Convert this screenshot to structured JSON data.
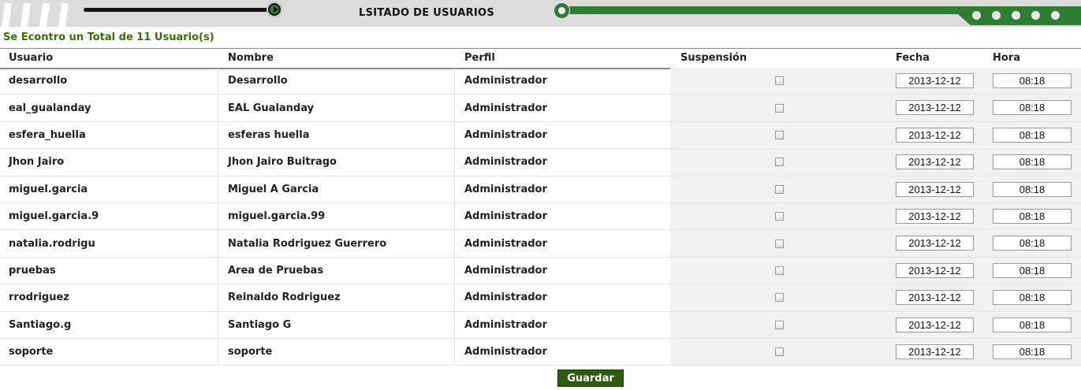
{
  "header": {
    "title": "LSITADO DE USUARIOS",
    "accent_color": "#2e7d32"
  },
  "summary": {
    "count_text": "Se Econtro un Total de 11 Usuario(s)",
    "color": "#3b6d0c"
  },
  "table": {
    "columns": {
      "usuario": "Usuario",
      "nombre": "Nombre",
      "perfil": "Perfil",
      "suspension": "Suspensión",
      "fecha": "Fecha",
      "hora": "Hora"
    },
    "rows": [
      {
        "usuario": "desarrollo",
        "nombre": "Desarrollo",
        "perfil": "Administrador",
        "suspendido": false,
        "fecha": "2013-12-12",
        "hora": "08:18"
      },
      {
        "usuario": "eal_gualanday",
        "nombre": "EAL Gualanday",
        "perfil": "Administrador",
        "suspendido": false,
        "fecha": "2013-12-12",
        "hora": "08:18"
      },
      {
        "usuario": "esfera_huella",
        "nombre": "esferas huella",
        "perfil": "Administrador",
        "suspendido": false,
        "fecha": "2013-12-12",
        "hora": "08:18"
      },
      {
        "usuario": "Jhon Jairo",
        "nombre": "Jhon Jairo Buitrago",
        "perfil": "Administrador",
        "suspendido": false,
        "fecha": "2013-12-12",
        "hora": "08:18"
      },
      {
        "usuario": "miguel.garcia",
        "nombre": "Miguel A Garcia",
        "perfil": "Administrador",
        "suspendido": false,
        "fecha": "2013-12-12",
        "hora": "08:18"
      },
      {
        "usuario": "miguel.garcia.9",
        "nombre": "miguel.garcia.99",
        "perfil": "Administrador",
        "suspendido": false,
        "fecha": "2013-12-12",
        "hora": "08:18"
      },
      {
        "usuario": "natalia.rodrigu",
        "nombre": "Natalia Rodriguez Guerrero",
        "perfil": "Administrador",
        "suspendido": false,
        "fecha": "2013-12-12",
        "hora": "08:18"
      },
      {
        "usuario": "pruebas",
        "nombre": "Area de Pruebas",
        "perfil": "Administrador",
        "suspendido": false,
        "fecha": "2013-12-12",
        "hora": "08:18"
      },
      {
        "usuario": "rrodriguez",
        "nombre": "Reinaldo Rodriguez",
        "perfil": "Administrador",
        "suspendido": false,
        "fecha": "2013-12-12",
        "hora": "08:18"
      },
      {
        "usuario": "Santiago.g",
        "nombre": "Santiago G",
        "perfil": "Administrador",
        "suspendido": false,
        "fecha": "2013-12-12",
        "hora": "08:18"
      },
      {
        "usuario": "soporte",
        "nombre": "soporte",
        "perfil": "Administrador",
        "suspendido": false,
        "fecha": "2013-12-12",
        "hora": "08:18"
      }
    ]
  },
  "actions": {
    "save_label": "Guardar",
    "save_color": "#2e5c0e"
  }
}
